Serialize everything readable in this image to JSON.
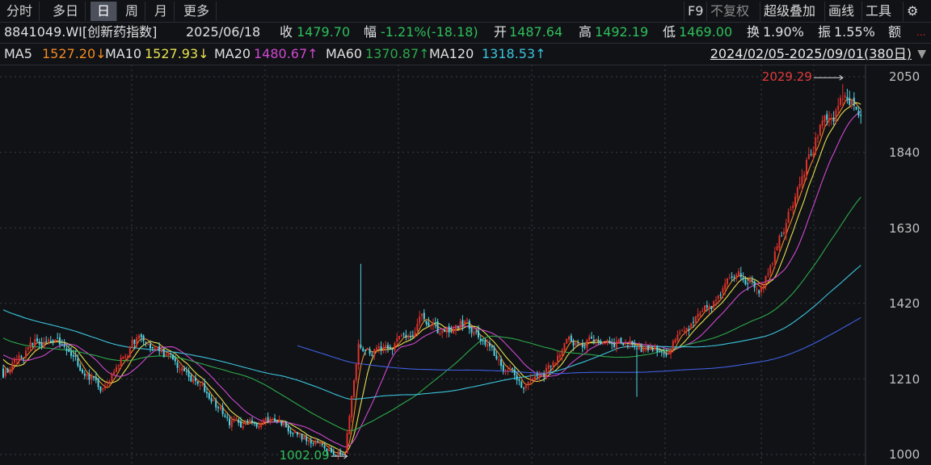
{
  "tabs": [
    {
      "label": "分时"
    },
    {
      "label": "多日"
    },
    {
      "label": "日",
      "active": true
    },
    {
      "label": "周"
    },
    {
      "label": "月"
    },
    {
      "label": "更多"
    }
  ],
  "tools": {
    "f9": "F9",
    "adjust": "不复权",
    "overlay": "超级叠加",
    "draw": "画线",
    "tools": "工具",
    "settings_icon": "gear-icon"
  },
  "info": {
    "security": "8841049.WI[创新药指数]",
    "date": "2025/06/18",
    "close_label": "收",
    "close": "1479.70",
    "change_label": "幅",
    "change": "-1.21%(-18.18)",
    "open_label": "开",
    "open": "1487.64",
    "high_label": "高",
    "high": "1492.19",
    "low_label": "低",
    "low": "1469.00",
    "turnover_label": "换",
    "turnover": "1.90%",
    "amplitude_label": "振",
    "amplitude": "1.55%",
    "amount_label": "额",
    "amount": "..."
  },
  "ma_legend": [
    {
      "name": "MA5",
      "value": "1527.20↓",
      "color": "#f08a24"
    },
    {
      "name": "MA10",
      "value": "1527.93↓",
      "color": "#e8e050"
    },
    {
      "name": "MA20",
      "value": "1480.67↑",
      "color": "#d048d0"
    },
    {
      "name": "MA60",
      "value": "1370.87↑",
      "color": "#2ea84a"
    },
    {
      "name": "MA120",
      "value": "1318.53↑",
      "color": "#3cc4dc"
    }
  ],
  "range_label": "2024/02/05-2025/09/01(380日)",
  "colors": {
    "up": "#e0302a",
    "down": "#54d2e0",
    "ma250": "#4060e0",
    "grid": "#3a3d44"
  },
  "chart_data": {
    "type": "candlestick",
    "bars": 380,
    "y_ticks": [
      "2050",
      "1840",
      "1630",
      "1420",
      "1210",
      "1000"
    ],
    "ylim": [
      1000,
      2050
    ],
    "max_label": "2029.29",
    "min_label": "1002.09",
    "max_index": 371,
    "min_index": 152,
    "prehistory_keypoints": [
      [
        -120,
        1550
      ],
      [
        -80,
        1460
      ],
      [
        -40,
        1350
      ],
      [
        -1,
        1260
      ]
    ],
    "close_keypoints": [
      [
        0,
        1230
      ],
      [
        14,
        1310
      ],
      [
        25,
        1300
      ],
      [
        43,
        1190
      ],
      [
        59,
        1320
      ],
      [
        71,
        1280
      ],
      [
        93,
        1150
      ],
      [
        100,
        1090
      ],
      [
        107,
        1085
      ],
      [
        121,
        1100
      ],
      [
        136,
        1030
      ],
      [
        151,
        1010
      ],
      [
        157,
        1300
      ],
      [
        162,
        1290
      ],
      [
        179,
        1330
      ],
      [
        184,
        1380
      ],
      [
        193,
        1330
      ],
      [
        204,
        1370
      ],
      [
        214,
        1290
      ],
      [
        229,
        1195
      ],
      [
        239,
        1230
      ],
      [
        250,
        1310
      ],
      [
        271,
        1320
      ],
      [
        282,
        1300
      ],
      [
        293,
        1290
      ],
      [
        307,
        1370
      ],
      [
        318,
        1450
      ],
      [
        325,
        1520
      ],
      [
        334,
        1460
      ],
      [
        343,
        1600
      ],
      [
        352,
        1780
      ],
      [
        361,
        1900
      ],
      [
        366,
        1920
      ],
      [
        373,
        1990
      ],
      [
        379,
        1940
      ]
    ],
    "spikes": [
      {
        "index": 158,
        "high": 1530
      },
      {
        "index": 280,
        "low": 1160
      }
    ]
  }
}
